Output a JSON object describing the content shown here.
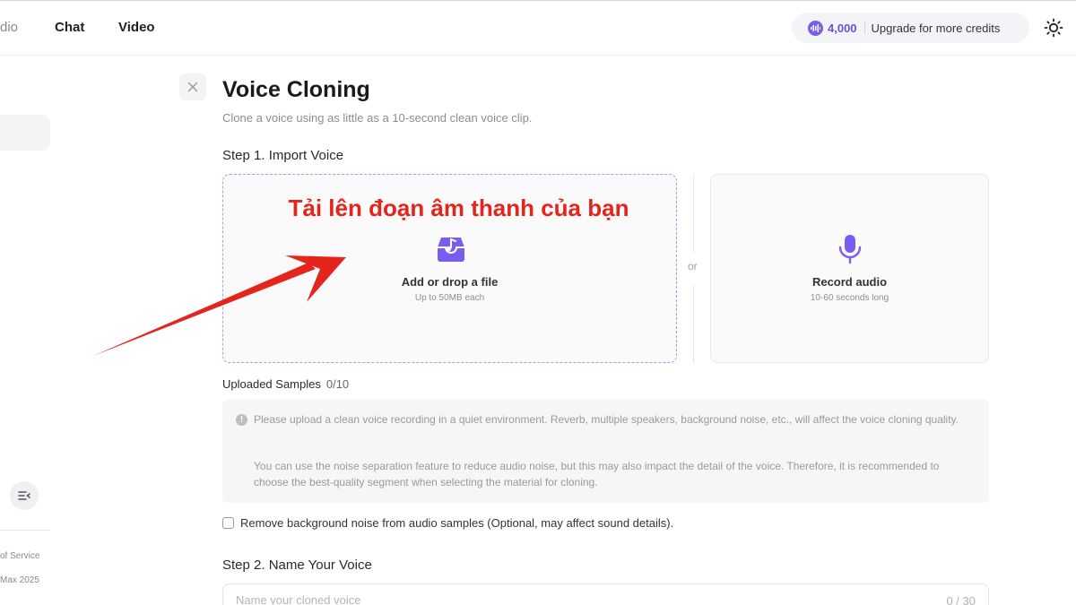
{
  "header": {
    "nav": [
      "dio",
      "Chat",
      "Video"
    ],
    "credits": {
      "count": "4,000",
      "label": "Upgrade for more credits",
      "icon": "audio-wave-icon",
      "accent": "#7a5cf0"
    },
    "theme_icon": "sun-icon"
  },
  "sidebar": {
    "collapse_icon": "collapse-sidebar-icon",
    "footer": [
      "of Service",
      "Max 2025"
    ]
  },
  "page": {
    "title": "Voice Cloning",
    "subtitle": "Clone a voice using as little as a 10-second clean voice clip.",
    "close_icon": "close-icon"
  },
  "step1": {
    "title": "Step 1. Import Voice",
    "upload": {
      "annotation": "Tải lên đoạn âm thanh của bạn",
      "label": "Add or drop a file",
      "hint": "Up to 50MB each",
      "icon": "file-upload-icon"
    },
    "or_text": "or",
    "record": {
      "label": "Record audio",
      "hint": "10-60 seconds long",
      "icon": "microphone-icon"
    }
  },
  "samples": {
    "label": "Uploaded Samples",
    "count": "0/10",
    "notice": [
      "Please upload a clean voice recording in a quiet environment. Reverb, multiple speakers, background noise, etc., will affect the voice cloning quality.",
      "You can use the noise separation feature to reduce audio noise, but this may also impact the detail of the voice. Therefore, it is recommended to choose the best-quality segment when selecting the material for cloning."
    ],
    "checkbox_label": "Remove background noise from audio samples (Optional, may affect sound details).",
    "checkbox_checked": false
  },
  "step2": {
    "title": "Step 2. Name Your Voice",
    "placeholder": "Name your cloned voice",
    "value": "",
    "counter": "0 / 30"
  },
  "colors": {
    "annotation": "#e4251b",
    "accent": "#7a5cf0"
  }
}
